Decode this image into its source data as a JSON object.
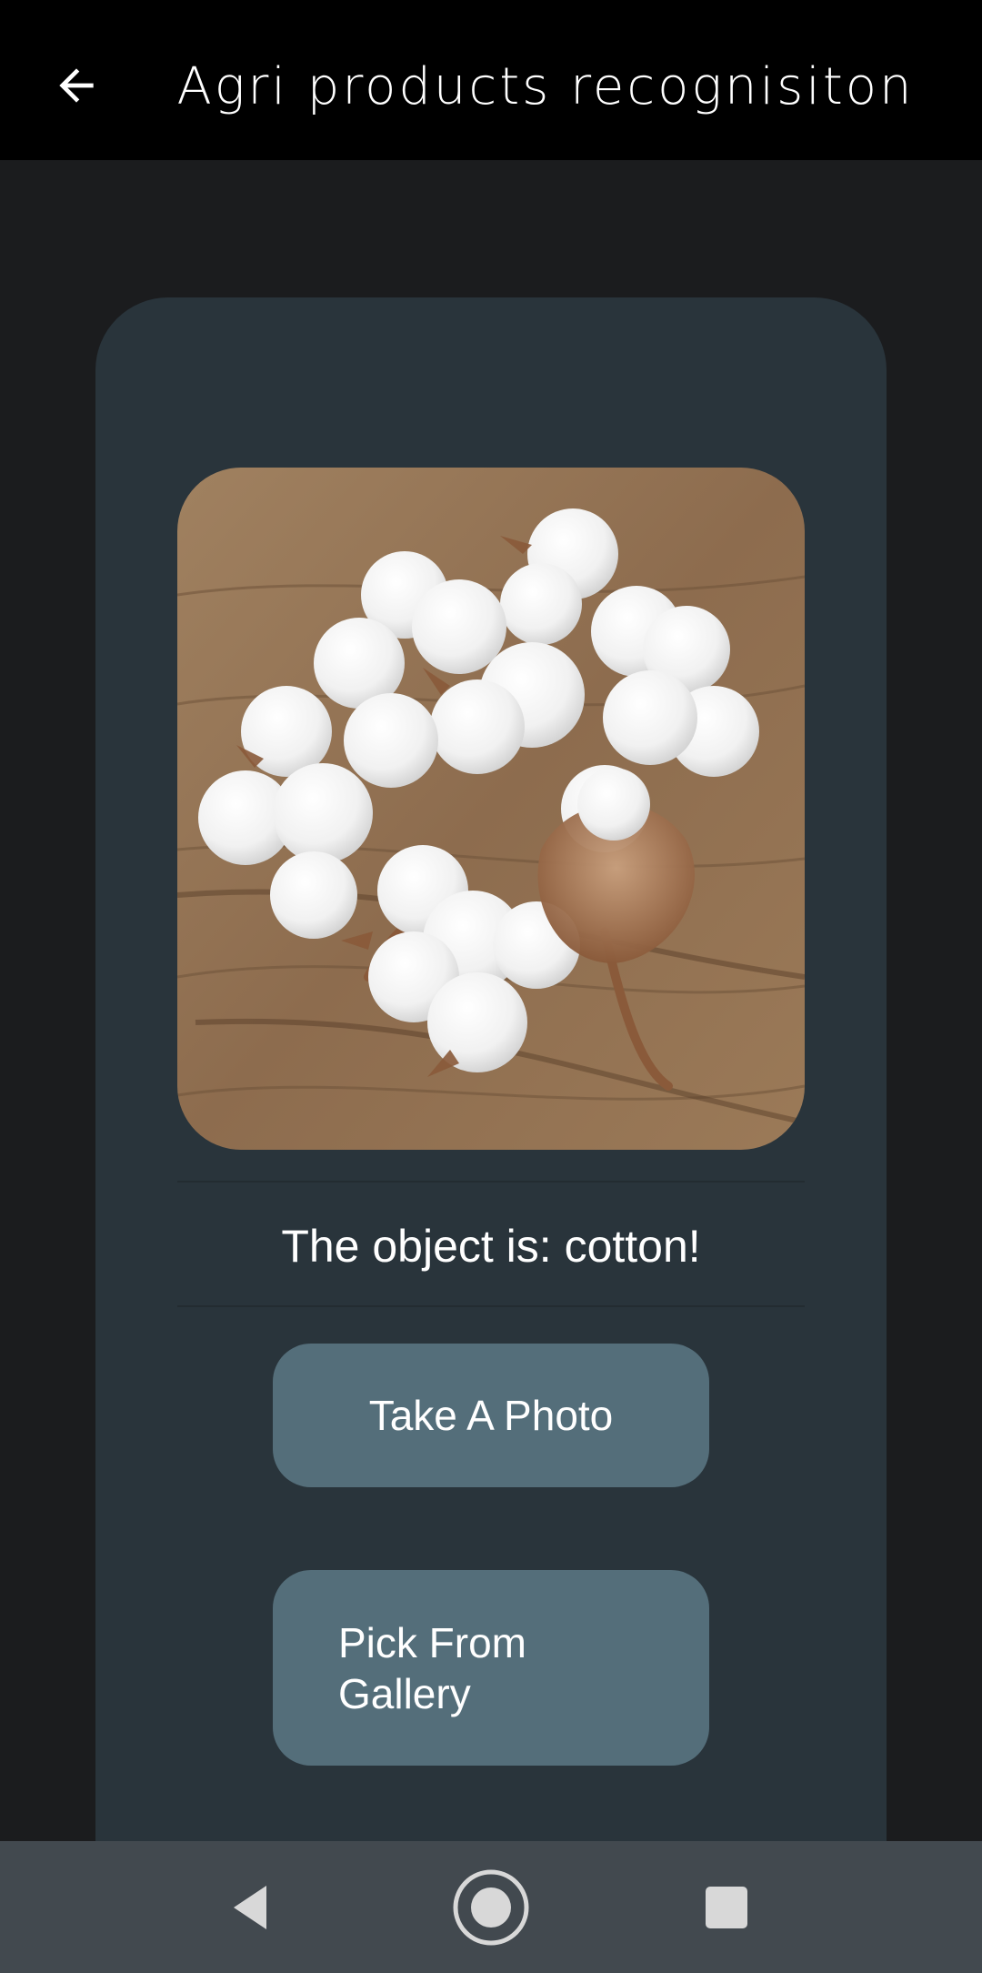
{
  "app_bar": {
    "title": "Agri products recognisiton",
    "back_icon": "arrow-back-icon"
  },
  "result": {
    "text": "The object is: cotton!"
  },
  "buttons": {
    "take_photo": "Take A Photo",
    "pick_gallery": "Pick From Gallery"
  },
  "nav_bar": {
    "back_icon": "nav-back-icon",
    "home_icon": "nav-home-icon",
    "recents_icon": "nav-recents-icon"
  },
  "colors": {
    "app_bar": "#000000",
    "background": "#1b1c1e",
    "card": "#29343b",
    "button": "#546e7a",
    "nav_bar": "#42494f",
    "text": "#ffffff"
  }
}
